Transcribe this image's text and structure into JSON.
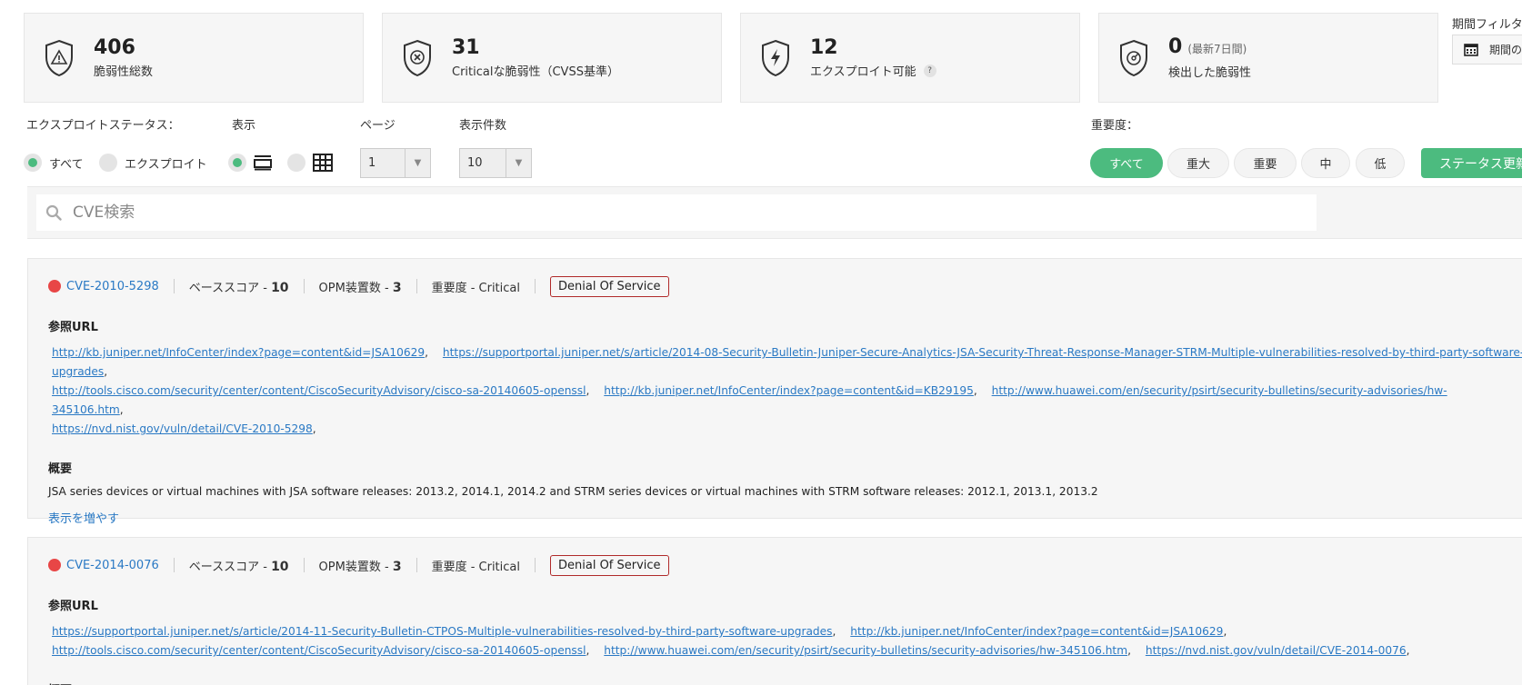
{
  "cards": [
    {
      "value": "406",
      "sub": "",
      "label": "脆弱性総数",
      "help": false,
      "icon": "shield-warning-icon"
    },
    {
      "value": "31",
      "sub": "",
      "label": "Criticalな脆弱性（CVSS基準）",
      "help": false,
      "icon": "shield-x-icon"
    },
    {
      "value": "12",
      "sub": "",
      "label": "エクスプロイト可能",
      "help": true,
      "icon": "shield-bolt-icon"
    },
    {
      "value": "0",
      "sub": "(最新7日間)",
      "label": "検出した脆弱性",
      "help": false,
      "icon": "shield-radar-icon"
    }
  ],
  "help_glyph": "?",
  "period": {
    "label": "期間フィルタ",
    "button": "期間の"
  },
  "filters": {
    "exploit_status_label": "エクスプロイトステータス：",
    "exploit_options": [
      "すべて",
      "エクスプロイト"
    ],
    "view_label": "表示",
    "page_label": "ページ",
    "page_value": "1",
    "count_label": "表示件数",
    "count_value": "10",
    "severity_label": "重要度：",
    "severity_options": [
      "すべて",
      "重大",
      "重要",
      "中",
      "低"
    ],
    "status_button": "ステータス更新"
  },
  "search": {
    "placeholder": "CVE検索"
  },
  "cves": [
    {
      "id": "CVE-2010-5298",
      "base_score_label": "ベーススコア -",
      "base_score": "10",
      "devices_label": "OPM装置数 -",
      "devices": "3",
      "severity": "重要度 - Critical",
      "tag": "Denial Of Service",
      "ref_title": "参照URL",
      "urls": [
        "http://kb.juniper.net/InfoCenter/index?page=content&id=JSA10629",
        "https://supportportal.juniper.net/s/article/2014-08-Security-Bulletin-Juniper-Secure-Analytics-JSA-Security-Threat-Response-Manager-STRM-Multiple-vulnerabilities-resolved-by-third-party-software-upgrades",
        "http://tools.cisco.com/security/center/content/CiscoSecurityAdvisory/cisco-sa-20140605-openssl",
        "http://kb.juniper.net/InfoCenter/index?page=content&id=KB29195",
        "http://www.huawei.com/en/security/psirt/security-bulletins/security-advisories/hw-345106.htm",
        "https://nvd.nist.gov/vuln/detail/CVE-2010-5298"
      ],
      "summary_title": "概要",
      "summary": "JSA series devices or virtual machines with JSA software releases: 2013.2, 2014.1, 2014.2 and STRM series devices or virtual machines with STRM software releases: 2012.1, 2013.1, 2013.2",
      "more": "表示を増やす"
    },
    {
      "id": "CVE-2014-0076",
      "base_score_label": "ベーススコア -",
      "base_score": "10",
      "devices_label": "OPM装置数 -",
      "devices": "3",
      "severity": "重要度 - Critical",
      "tag": "Denial Of Service",
      "ref_title": "参照URL",
      "urls": [
        "https://supportportal.juniper.net/s/article/2014-11-Security-Bulletin-CTPOS-Multiple-vulnerabilities-resolved-by-third-party-software-upgrades",
        "http://kb.juniper.net/InfoCenter/index?page=content&id=JSA10629",
        "http://tools.cisco.com/security/center/content/CiscoSecurityAdvisory/cisco-sa-20140605-openssl",
        "http://www.huawei.com/en/security/psirt/security-bulletins/security-advisories/hw-345106.htm",
        "https://nvd.nist.gov/vuln/detail/CVE-2014-0076"
      ],
      "summary_title": "概要"
    }
  ],
  "colors": {
    "accent": "#4cbb7f",
    "link": "#2a79c4",
    "critical": "#e84646",
    "tag_border": "#b02a2a"
  }
}
